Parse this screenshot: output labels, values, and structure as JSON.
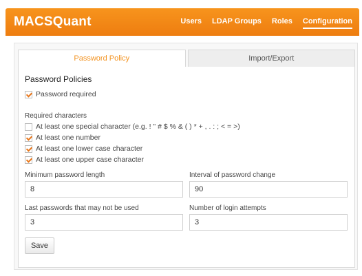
{
  "app": {
    "brand": "MACSQuant",
    "nav": [
      {
        "label": "Users"
      },
      {
        "label": "LDAP Groups"
      },
      {
        "label": "Roles"
      },
      {
        "label": "Configuration",
        "active": true
      }
    ]
  },
  "tabs": [
    {
      "label": "Password Policy",
      "active": true
    },
    {
      "label": "Import/Export",
      "active": false
    }
  ],
  "policy": {
    "title": "Password Policies",
    "password_required": {
      "label": "Password required",
      "checked": true
    },
    "required_chars_heading": "Required characters",
    "options": [
      {
        "label": "At least one special character (e.g. ! \" # $ % & ( ) * + , . : ; < = >)",
        "checked": false
      },
      {
        "label": "At least one number",
        "checked": true
      },
      {
        "label": "At least one lower case character",
        "checked": true
      },
      {
        "label": "At least one upper case character",
        "checked": true
      }
    ]
  },
  "fields": {
    "min_length": {
      "label": "Minimum password length",
      "value": "8"
    },
    "interval": {
      "label": "Interval of password change",
      "value": "90"
    },
    "last_passwords": {
      "label": "Last passwords that may not be used",
      "value": "3"
    },
    "login_attempts": {
      "label": "Number of login attempts",
      "value": "3"
    }
  },
  "save_label": "Save",
  "colors": {
    "accent": "#f39321",
    "topbar": "#ee7d10"
  }
}
